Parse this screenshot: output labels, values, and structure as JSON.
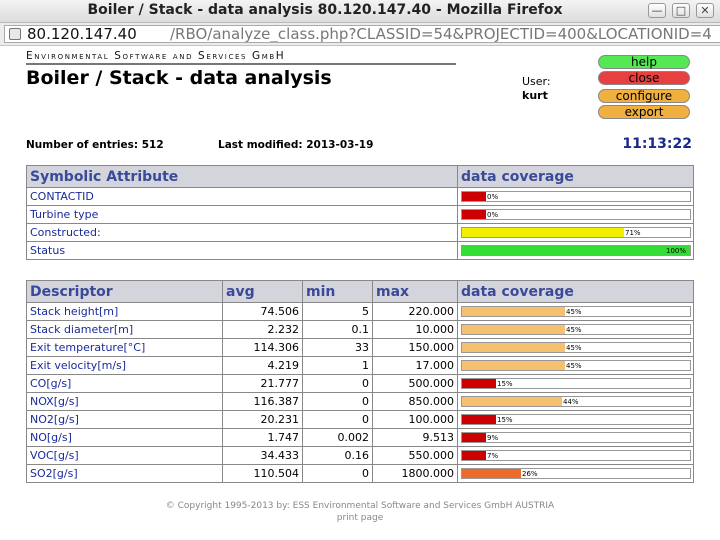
{
  "window": {
    "title": "Boiler / Stack - data analysis 80.120.147.40 - Mozilla Firefox",
    "minimize_glyph": "—",
    "maximize_glyph": "□",
    "close_glyph": "✕"
  },
  "urlbar": {
    "host": "80.120.147.40",
    "path": "/RBO/analyze_class.php?CLASSID=54&PROJECTID=400&LOCATIONID=4"
  },
  "header": {
    "company": "Environmental Software and Services GmbH",
    "page_title": "Boiler / Stack - data analysis",
    "user_label": "User:",
    "user_name": "kurt"
  },
  "buttons": {
    "help": "help",
    "close": "close",
    "configure": "configure",
    "export": "export"
  },
  "buttons_colors": {
    "help": "#55e855",
    "close": "#e84040",
    "configure": "#f0b040",
    "export": "#f0b040"
  },
  "info": {
    "entries": "Number of entries: 512",
    "modified": "Last modified: 2013-03-19",
    "clock": "11:13:22"
  },
  "symbolic": {
    "header_attribute": "Symbolic Attribute",
    "header_coverage": "data coverage",
    "rows": [
      {
        "name": "CONTACTID",
        "coverage": 0,
        "label": "0%",
        "color": "#cc0000"
      },
      {
        "name": "Turbine type",
        "coverage": 0,
        "label": "0%",
        "color": "#cc0000"
      },
      {
        "name": "Constructed:",
        "coverage": 71,
        "label": "71%",
        "color": "#f0f000"
      },
      {
        "name": "Status",
        "coverage": 100,
        "label": "100%",
        "color": "#33dd33"
      }
    ]
  },
  "descriptors": {
    "header_descriptor": "Descriptor",
    "header_avg": "avg",
    "header_min": "min",
    "header_max": "max",
    "header_coverage": "data coverage",
    "rows": [
      {
        "name": "Stack height[m]",
        "avg": "74.506",
        "min": "5",
        "max": "220.000",
        "coverage": 45,
        "label": "45%",
        "color": "#f5c070"
      },
      {
        "name": "Stack diameter[m]",
        "avg": "2.232",
        "min": "0.1",
        "max": "10.000",
        "coverage": 45,
        "label": "45%",
        "color": "#f5c070"
      },
      {
        "name": "Exit temperature[°C]",
        "avg": "114.306",
        "min": "33",
        "max": "150.000",
        "coverage": 45,
        "label": "45%",
        "color": "#f5c070"
      },
      {
        "name": "Exit velocity[m/s]",
        "avg": "4.219",
        "min": "1",
        "max": "17.000",
        "coverage": 45,
        "label": "45%",
        "color": "#f5c070"
      },
      {
        "name": "CO[g/s]",
        "avg": "21.777",
        "min": "0",
        "max": "500.000",
        "coverage": 15,
        "label": "15%",
        "color": "#cc0000"
      },
      {
        "name": "NOX[g/s]",
        "avg": "116.387",
        "min": "0",
        "max": "850.000",
        "coverage": 44,
        "label": "44%",
        "color": "#f5c070"
      },
      {
        "name": "NO2[g/s]",
        "avg": "20.231",
        "min": "0",
        "max": "100.000",
        "coverage": 15,
        "label": "15%",
        "color": "#cc0000"
      },
      {
        "name": "NO[g/s]",
        "avg": "1.747",
        "min": "0.002",
        "max": "9.513",
        "coverage": 9,
        "label": "9%",
        "color": "#cc0000"
      },
      {
        "name": "VOC[g/s]",
        "avg": "34.433",
        "min": "0.16",
        "max": "550.000",
        "coverage": 7,
        "label": "7%",
        "color": "#cc0000"
      },
      {
        "name": "SO2[g/s]",
        "avg": "110.504",
        "min": "0",
        "max": "1800.000",
        "coverage": 26,
        "label": "26%",
        "color": "#ee6a2a"
      }
    ]
  },
  "footer": {
    "copyright": "© Copyright 1995-2013 by:   ESS   Environmental Software and Services GmbH AUSTRIA",
    "print": "print page"
  }
}
